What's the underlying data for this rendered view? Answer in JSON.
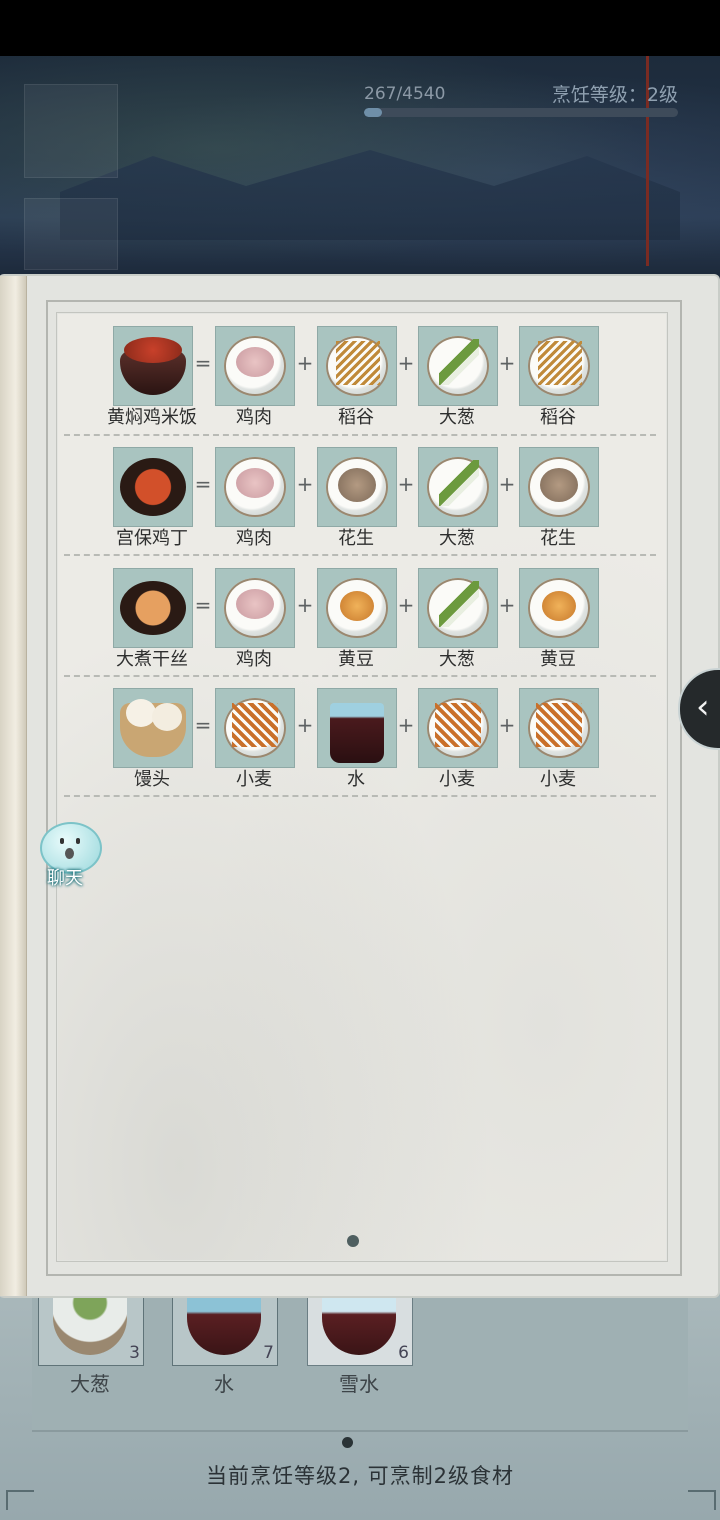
{
  "header": {
    "xp_text": "267/4540",
    "xp_progress": 0.0588,
    "level_text": "烹饪等级：2级"
  },
  "recipes": [
    {
      "dish": {
        "label": "黄焖鸡米饭",
        "icon": "huangmen-chicken-rice-icon"
      },
      "ingredients": [
        {
          "label": "鸡肉",
          "icon": "chicken-meat-icon"
        },
        {
          "label": "稻谷",
          "icon": "rice-grain-icon"
        },
        {
          "label": "大葱",
          "icon": "scallion-icon"
        },
        {
          "label": "稻谷",
          "icon": "rice-grain-icon"
        }
      ]
    },
    {
      "dish": {
        "label": "宫保鸡丁",
        "icon": "kung-pao-chicken-icon"
      },
      "ingredients": [
        {
          "label": "鸡肉",
          "icon": "chicken-meat-icon"
        },
        {
          "label": "花生",
          "icon": "peanut-icon"
        },
        {
          "label": "大葱",
          "icon": "scallion-icon"
        },
        {
          "label": "花生",
          "icon": "peanut-icon"
        }
      ]
    },
    {
      "dish": {
        "label": "大煮干丝",
        "icon": "tofu-shreds-icon"
      },
      "ingredients": [
        {
          "label": "鸡肉",
          "icon": "chicken-meat-icon"
        },
        {
          "label": "黄豆",
          "icon": "soybean-icon"
        },
        {
          "label": "大葱",
          "icon": "scallion-icon"
        },
        {
          "label": "黄豆",
          "icon": "soybean-icon"
        }
      ]
    },
    {
      "dish": {
        "label": "馒头",
        "icon": "steamed-bun-icon"
      },
      "ingredients": [
        {
          "label": "小麦",
          "icon": "wheat-icon"
        },
        {
          "label": "水",
          "icon": "water-bucket-icon"
        },
        {
          "label": "小麦",
          "icon": "wheat-icon"
        },
        {
          "label": "小麦",
          "icon": "wheat-icon"
        }
      ]
    }
  ],
  "operators": {
    "equals": "=",
    "plus": "+"
  },
  "chat": {
    "label": "聊天",
    "icon": "chat-ghost-icon"
  },
  "side_toggle": {
    "icon": "chevron-left-icon",
    "glyph": "‹"
  },
  "inventory": [
    {
      "label": "大葱",
      "count": "3",
      "icon": "scallion-icon"
    },
    {
      "label": "水",
      "count": "7",
      "icon": "water-bucket-icon"
    },
    {
      "label": "雪水",
      "count": "6",
      "icon": "snow-water-bucket-icon",
      "selected": true
    }
  ],
  "footer": {
    "text": "当前烹饪等级2, 可烹制2级食材"
  },
  "colors": {
    "cell_bg": "#a9c4c0",
    "page_bg": "#ecebe6",
    "xp_fill": "#6f8fa8"
  }
}
